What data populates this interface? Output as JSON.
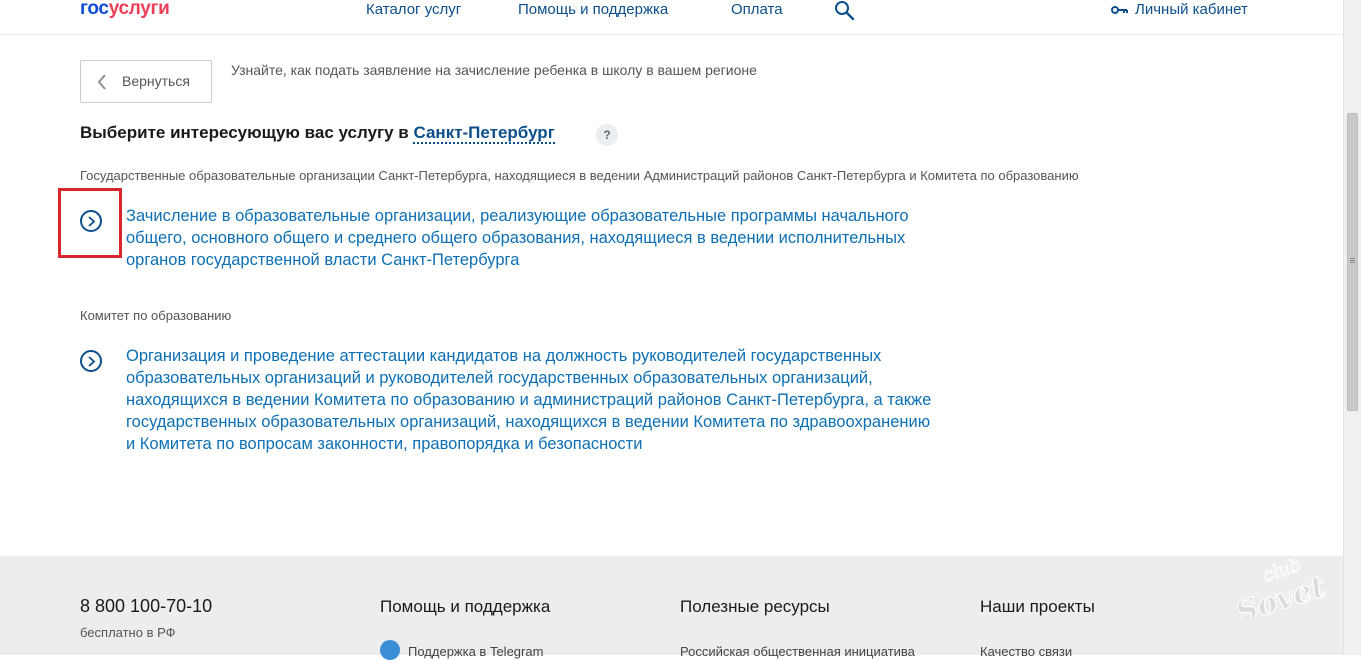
{
  "header": {
    "logo_part1": "гос",
    "logo_part2": "услуги",
    "nav": [
      "Каталог услуг",
      "Помощь и поддержка",
      "Оплата"
    ],
    "cabinet": "Личный кабинет"
  },
  "back": {
    "label": "Вернуться",
    "hint": "Узнайте, как подать заявление на зачисление ребенка в школу в вашем регионе"
  },
  "heading": {
    "text": "Выберите интересующую вас услугу в ",
    "city": "Санкт-Петербург",
    "help": "?"
  },
  "sections": [
    {
      "label": "Государственные образовательные организации Санкт-Петербурга, находящиеся в ведении Администраций районов Санкт-Петербурга и Комитета по образованию",
      "service_lines": [
        "Зачисление в образовательные организации, реализующие образовательные программы начального",
        "общего, основного общего и среднего общего образования, находящиеся в ведении исполнительных",
        "органов государственной власти Санкт-Петербурга"
      ]
    },
    {
      "label": "Комитет по образованию",
      "service_lines": [
        "Организация и проведение аттестации кандидатов на должность руководителей государственных",
        "образовательных организаций и руководителей государственных образовательных организаций,",
        "находящихся в ведении Комитета по образованию и администраций районов Санкт-Петербурга, а также",
        "государственных образовательных организаций, находящихся в ведении Комитета по здравоохранению",
        "и Комитета по вопросам законности, правопорядка и безопасности"
      ]
    }
  ],
  "footer": {
    "phone": "8 800 100-70-10",
    "phone_note": "бесплатно в РФ",
    "columns": [
      "Помощь и поддержка",
      "Полезные ресурсы",
      "Наши проекты"
    ],
    "links": [
      "Поддержка в Telegram",
      "Российская общественная инициатива",
      "Качество связи"
    ]
  },
  "watermark": {
    "line1": "club",
    "line2": "Sovet"
  },
  "colors": {
    "link": "#0d6fb4",
    "highlight": "#d8262f",
    "footer_bg": "#ebedef"
  }
}
